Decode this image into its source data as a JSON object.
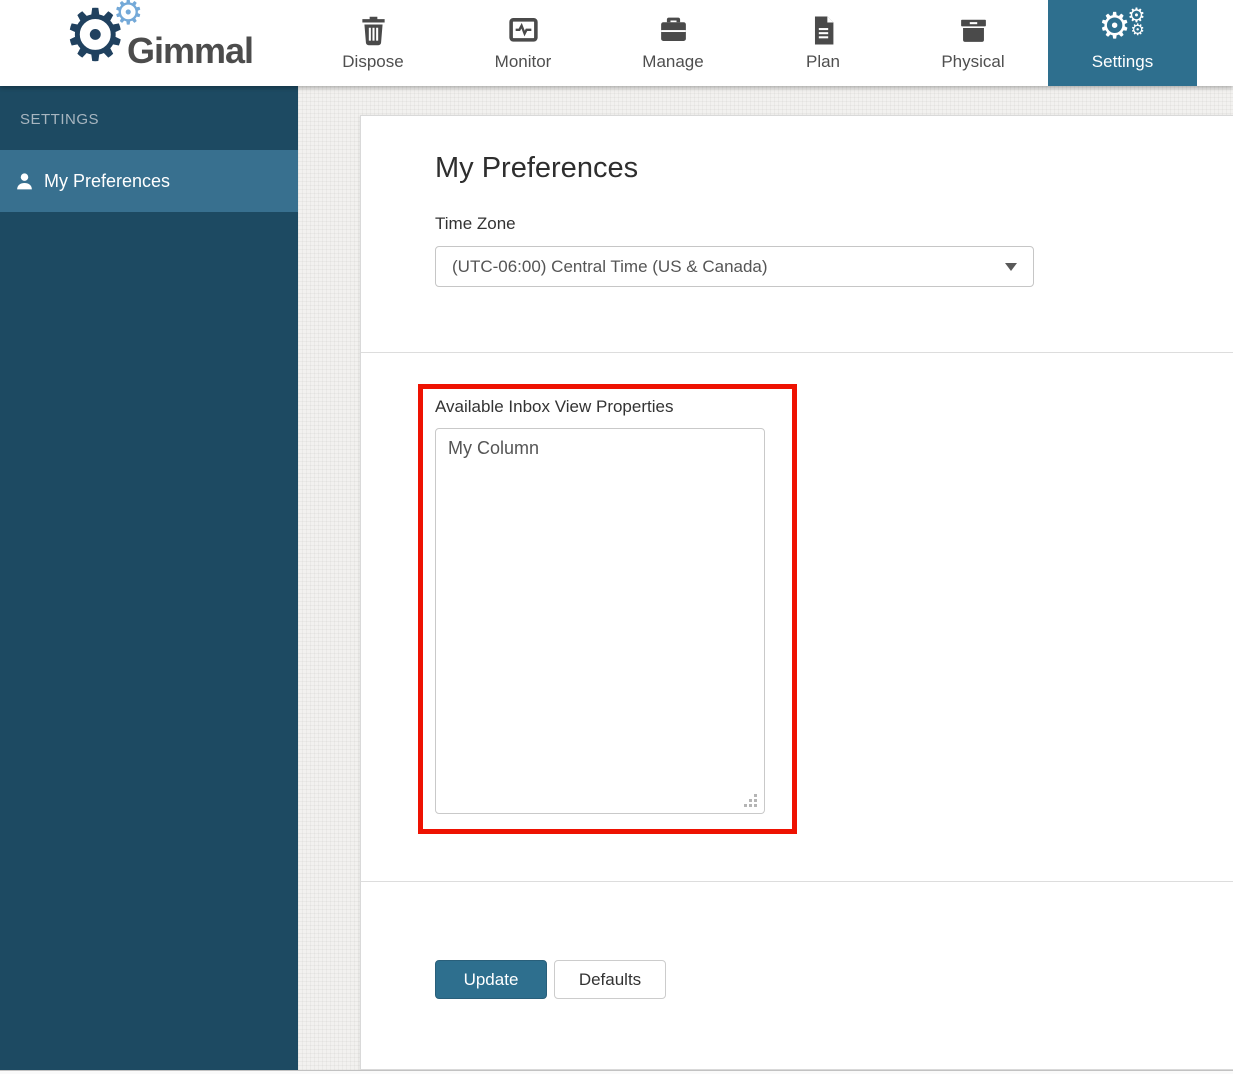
{
  "brand": {
    "name": "Gimmal"
  },
  "icons": {
    "gear_glyph": "⚙"
  },
  "nav": {
    "items": [
      {
        "label": "Dispose",
        "icon": "trash-icon",
        "active": false
      },
      {
        "label": "Monitor",
        "icon": "monitor-icon",
        "active": false
      },
      {
        "label": "Manage",
        "icon": "briefcase-icon",
        "active": false
      },
      {
        "label": "Plan",
        "icon": "document-icon",
        "active": false
      },
      {
        "label": "Physical",
        "icon": "archive-box-icon",
        "active": false
      },
      {
        "label": "Settings",
        "icon": "gears-icon",
        "active": true
      }
    ]
  },
  "sidebar": {
    "header": "SETTINGS",
    "items": [
      {
        "label": "My Preferences",
        "icon": "person-icon",
        "active": true
      }
    ]
  },
  "main": {
    "title": "My Preferences",
    "time_zone": {
      "label": "Time Zone",
      "selected_value": "(UTC-06:00) Central Time (US & Canada)"
    },
    "inbox_properties": {
      "label": "Available Inbox View Properties",
      "items": [
        "My Column"
      ]
    },
    "buttons": {
      "update": "Update",
      "defaults": "Defaults"
    }
  },
  "colors": {
    "sidebar_bg": "#1d4a62",
    "sidebar_active_bg": "#38708f",
    "accent_teal": "#2e6f8e",
    "highlight_red": "#ee1202",
    "nav_text": "#4f4f4f"
  }
}
